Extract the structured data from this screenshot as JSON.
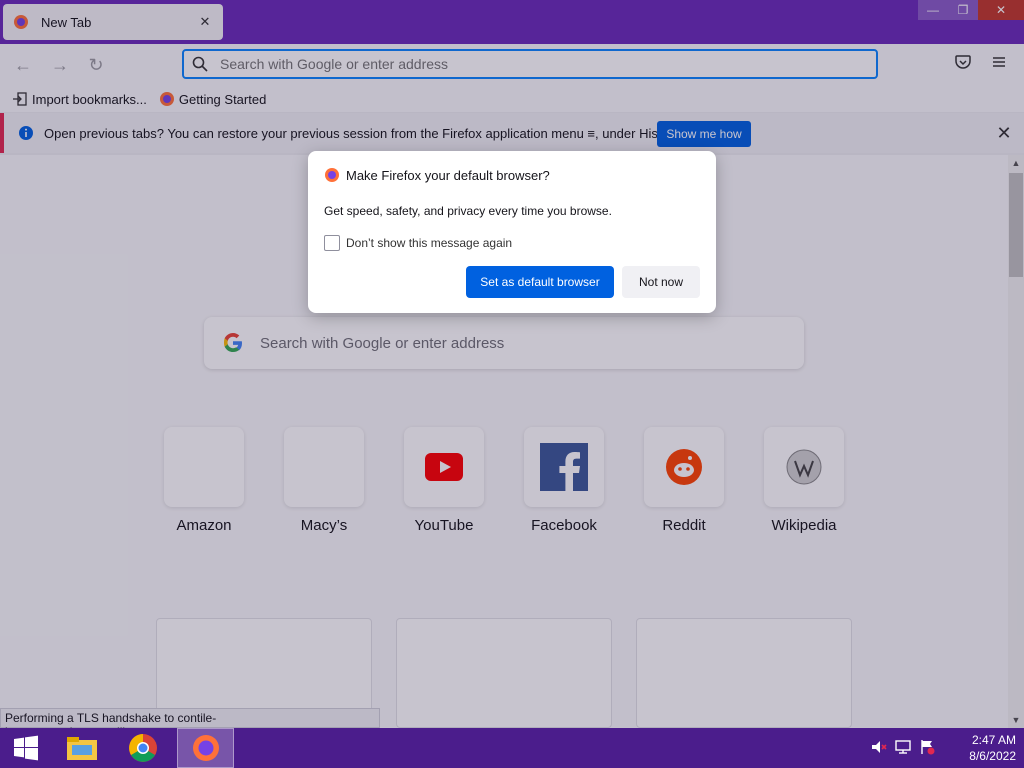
{
  "browser": {
    "tab": {
      "title": "New Tab"
    },
    "urlbar": {
      "placeholder": "Search with Google or enter address"
    },
    "bookmarks": [
      {
        "label": "Import bookmarks..."
      },
      {
        "label": "Getting Started"
      }
    ],
    "notification": {
      "message": "Open previous tabs? You can restore your previous session from the Firefox application menu ≡, under History.",
      "button": "Show me how"
    }
  },
  "dialog": {
    "title": "Make Firefox your default browser?",
    "body": "Get speed, safety, and privacy every time you browse.",
    "checkbox_label": "Don’t show this message again",
    "primary_button": "Set as default browser",
    "secondary_button": "Not now"
  },
  "newtab": {
    "search_placeholder": "Search with Google or enter address",
    "top_sites": [
      {
        "label": "Amazon"
      },
      {
        "label": "Macy’s"
      },
      {
        "label": "YouTube"
      },
      {
        "label": "Facebook"
      },
      {
        "label": "Reddit"
      },
      {
        "label": "Wikipedia"
      }
    ]
  },
  "statusbar": {
    "text": "Performing a TLS handshake to contile-images.services.mozilla.com..."
  },
  "taskbar": {
    "time": "2:47 AM",
    "date": "8/6/2022"
  },
  "colors": {
    "accent": "#0061e0",
    "titlebar": "#6a2bb8",
    "taskbar": "#4b1d8c"
  }
}
